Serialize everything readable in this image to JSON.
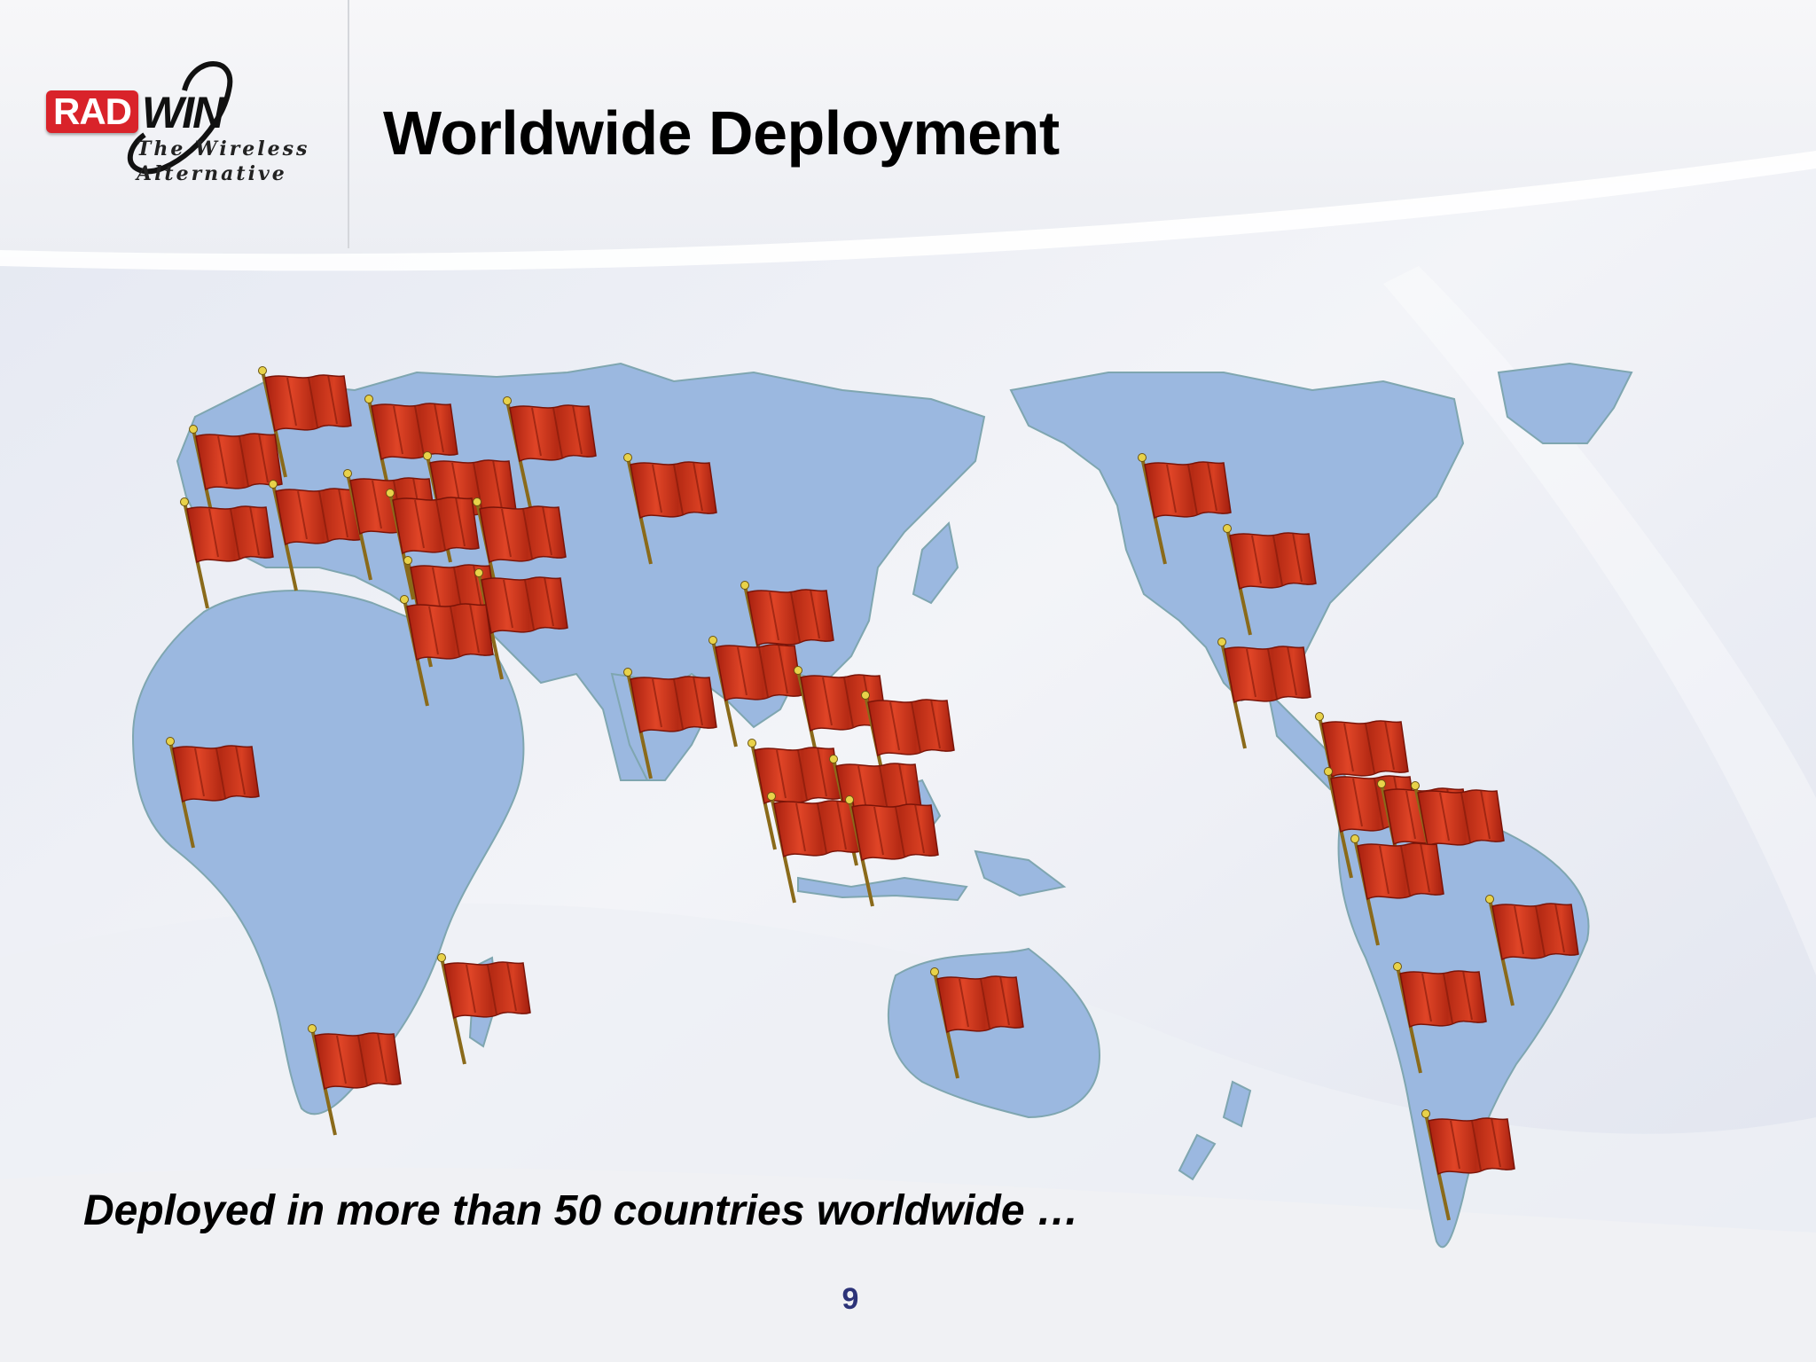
{
  "header": {
    "title": "Worldwide Deployment",
    "logo": {
      "brand_left": "RAD",
      "brand_right": "WIN",
      "tagline_line1": "The Wireless",
      "tagline_line2": "Alternative"
    }
  },
  "map": {
    "marker_icon": "red-flag-icon",
    "marker_color": "#c8321a",
    "continent_gradient": [
      "#e6f2ee",
      "#6aa7cf",
      "#2b2f85"
    ]
  },
  "caption": "Deployed in more than 50 countries worldwide …",
  "page_number": "9"
}
